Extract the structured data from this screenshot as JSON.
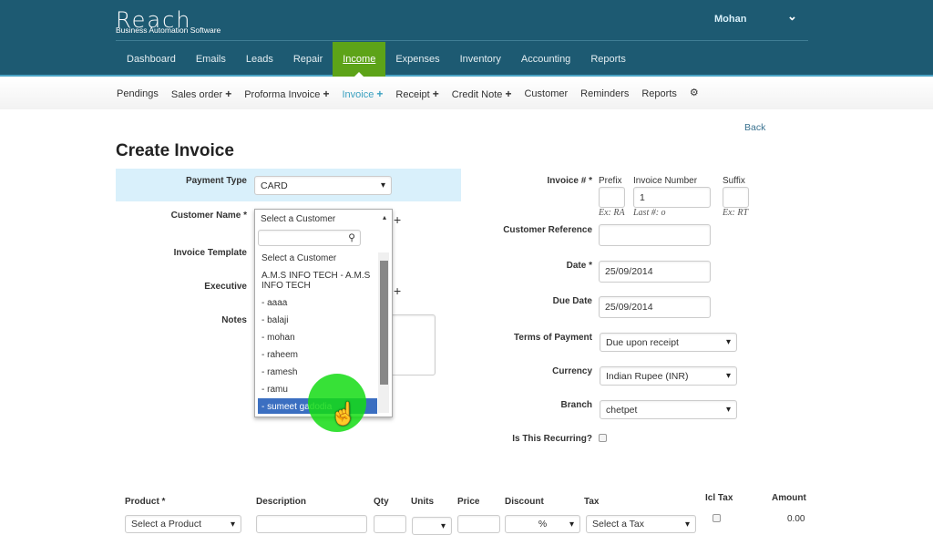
{
  "header": {
    "logo": "Reach",
    "logo_sub": "Business Automation Software",
    "user": "Mohan",
    "nav": [
      "Dashboard",
      "Emails",
      "Leads",
      "Repair",
      "Income",
      "Expenses",
      "Inventory",
      "Accounting",
      "Reports"
    ],
    "active_nav": "Income"
  },
  "subnav": {
    "items": [
      {
        "label": "Pendings",
        "plus": ""
      },
      {
        "label": "Sales order",
        "plus": "+"
      },
      {
        "label": "Proforma Invoice",
        "plus": "+"
      },
      {
        "label": "Invoice",
        "plus": "+"
      },
      {
        "label": "Receipt",
        "plus": "+"
      },
      {
        "label": "Credit Note",
        "plus": "+"
      },
      {
        "label": "Customer",
        "plus": ""
      },
      {
        "label": "Reminders",
        "plus": ""
      },
      {
        "label": "Reports",
        "plus": ""
      }
    ],
    "active": "Invoice"
  },
  "page": {
    "back": "Back",
    "title": "Create Invoice"
  },
  "left": {
    "payment_type_label": "Payment Type",
    "payment_type": "CARD",
    "customer_label": "Customer Name *",
    "customer_value": "Select a Customer",
    "template_label": "Invoice Template",
    "executive_label": "Executive",
    "notes_label": "Notes",
    "plus": "+"
  },
  "dropdown": {
    "search": "",
    "options": [
      "Select a Customer",
      "A.M.S INFO TECH - A.M.S INFO TECH",
      "- aaaa",
      "- balaji",
      "- mohan",
      "- raheem",
      "- ramesh",
      "- ramu",
      "- sumeet gadodia"
    ],
    "highlighted": "- sumeet gadodia"
  },
  "right": {
    "invoice_label": "Invoice # *",
    "prefix_label": "Prefix",
    "number_label": "Invoice Number",
    "suffix_label": "Suffix",
    "prefix": "",
    "number": "1",
    "suffix": "",
    "prefix_hint": "Ex: RA",
    "number_hint": "Last #: o",
    "suffix_hint": "Ex: RT",
    "custref_label": "Customer Reference",
    "custref": "",
    "date_label": "Date *",
    "date": "25/09/2014",
    "due_label": "Due Date",
    "due": "25/09/2014",
    "terms_label": "Terms of Payment",
    "terms": "Due upon receipt",
    "currency_label": "Currency",
    "currency": "Indian Rupee (INR)",
    "branch_label": "Branch",
    "branch": "chetpet",
    "recurring_label": "Is This Recurring?",
    "recurring": false
  },
  "items": {
    "headers": [
      "Product *",
      "Description",
      "Qty",
      "Units",
      "Price",
      "Discount",
      "Tax",
      "Icl Tax",
      "Amount"
    ],
    "product": "Select a Product",
    "discount_unit": "%",
    "tax": "Select a Tax",
    "amount": "0.00"
  },
  "colors": {
    "header": "#1d5a72",
    "active_nav": "#5da318",
    "highlight": "#3b6fc1",
    "band": "#d9f0fb"
  }
}
